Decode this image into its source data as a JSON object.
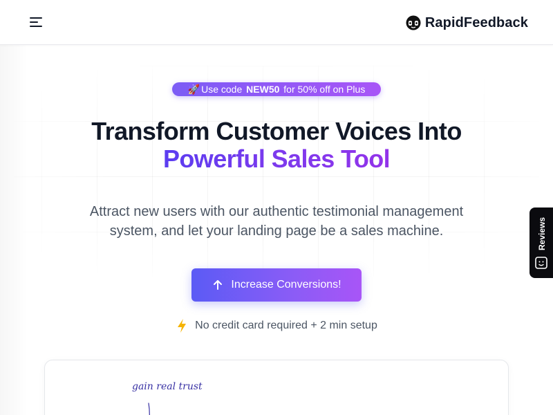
{
  "header": {
    "menu_icon": "menu-icon",
    "brand_name": "RapidFeedback",
    "brand_logo_icon": "headphones-smiley-icon"
  },
  "hero": {
    "promo": {
      "emoji": "🚀",
      "prefix": "Use code ",
      "code": "NEW50",
      "suffix": " for 50% off on Plus"
    },
    "headline_line1": "Transform Customer Voices Into",
    "headline_line2": "Powerful Sales Tool",
    "subtext": "Attract new users with our authentic testimonial management system, and let your landing page be a sales machine.",
    "cta_label": "Increase Conversions!",
    "cta_icon": "arrow-up-icon",
    "note_icon": "lightning-bolt-icon",
    "note": "No credit card required + 2 min setup"
  },
  "demo_card": {
    "handwritten_label": "gain real trust"
  },
  "reviews_tab": {
    "label": "Reviews",
    "icon": "smiley-box-icon"
  },
  "colors": {
    "accent_start": "#5b5bf5",
    "accent_end": "#a855f7",
    "headline_dark": "#111827",
    "body_text": "#4b5563",
    "bolt": "#f5b301",
    "tab_bg": "#0b0b0f"
  }
}
